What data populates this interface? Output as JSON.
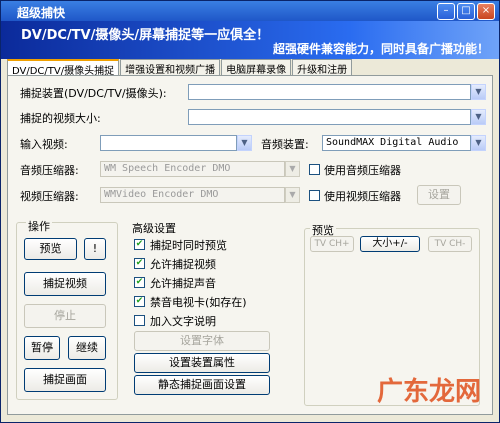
{
  "title": "超级捕快",
  "title_buttons": {
    "min": "–",
    "max": "□",
    "close": "×"
  },
  "banner": {
    "line1": "DV/DC/TV/摄像头/屏幕捕捉等一应俱全！",
    "line2": "超强硬件兼容能力，同时具备广播功能！"
  },
  "tabs": [
    {
      "label": "DV/DC/TV/摄像头捕捉"
    },
    {
      "label": "增强设置和视频广播"
    },
    {
      "label": "电脑屏幕录像"
    },
    {
      "label": "升级和注册"
    }
  ],
  "form": {
    "capture_device_label": "捕捉装置(DV/DC/TV/摄像头):",
    "capture_device_value": "",
    "video_size_label": "捕捉的视频大小:",
    "video_size_value": "",
    "input_video_label": "输入视频:",
    "input_video_value": "",
    "audio_device_label": "音频装置:",
    "audio_device_value": "SoundMAX Digital Audio",
    "audio_compressor_label": "音频压缩器:",
    "audio_compressor_value": "WM Speech Encoder DMO",
    "use_audio_compressor": "使用音频压缩器",
    "video_compressor_label": "视频压缩器:",
    "video_compressor_value": "WMVideo Encoder DMO",
    "use_video_compressor": "使用视频压缩器",
    "settings_button": "设置"
  },
  "operations": {
    "title": "操作",
    "preview": "预览",
    "preview_extra": "!",
    "capture_video": "捕捉视频",
    "stop": "停止",
    "pause": "暂停",
    "resume": "继续",
    "capture_frame": "捕捉画面"
  },
  "advanced": {
    "title": "高级设置",
    "options": [
      {
        "label": "捕捉时同时预览",
        "checked": true
      },
      {
        "label": "允许捕捉视频",
        "checked": true
      },
      {
        "label": "允许捕捉声音",
        "checked": true
      },
      {
        "label": "禁音电视卡(如存在)",
        "checked": true
      },
      {
        "label": "加入文字说明",
        "checked": false
      }
    ],
    "set_font": "设置字体",
    "device_props": "设置装置属性",
    "still_capture_settings": "静态捕捉画面设置"
  },
  "preview_group": {
    "title": "预览",
    "tv_ch_plus": "TV CH+",
    "size_btn": "大小+/-",
    "tv_ch_minus": "TV CH-"
  },
  "watermark": "广东龙网"
}
